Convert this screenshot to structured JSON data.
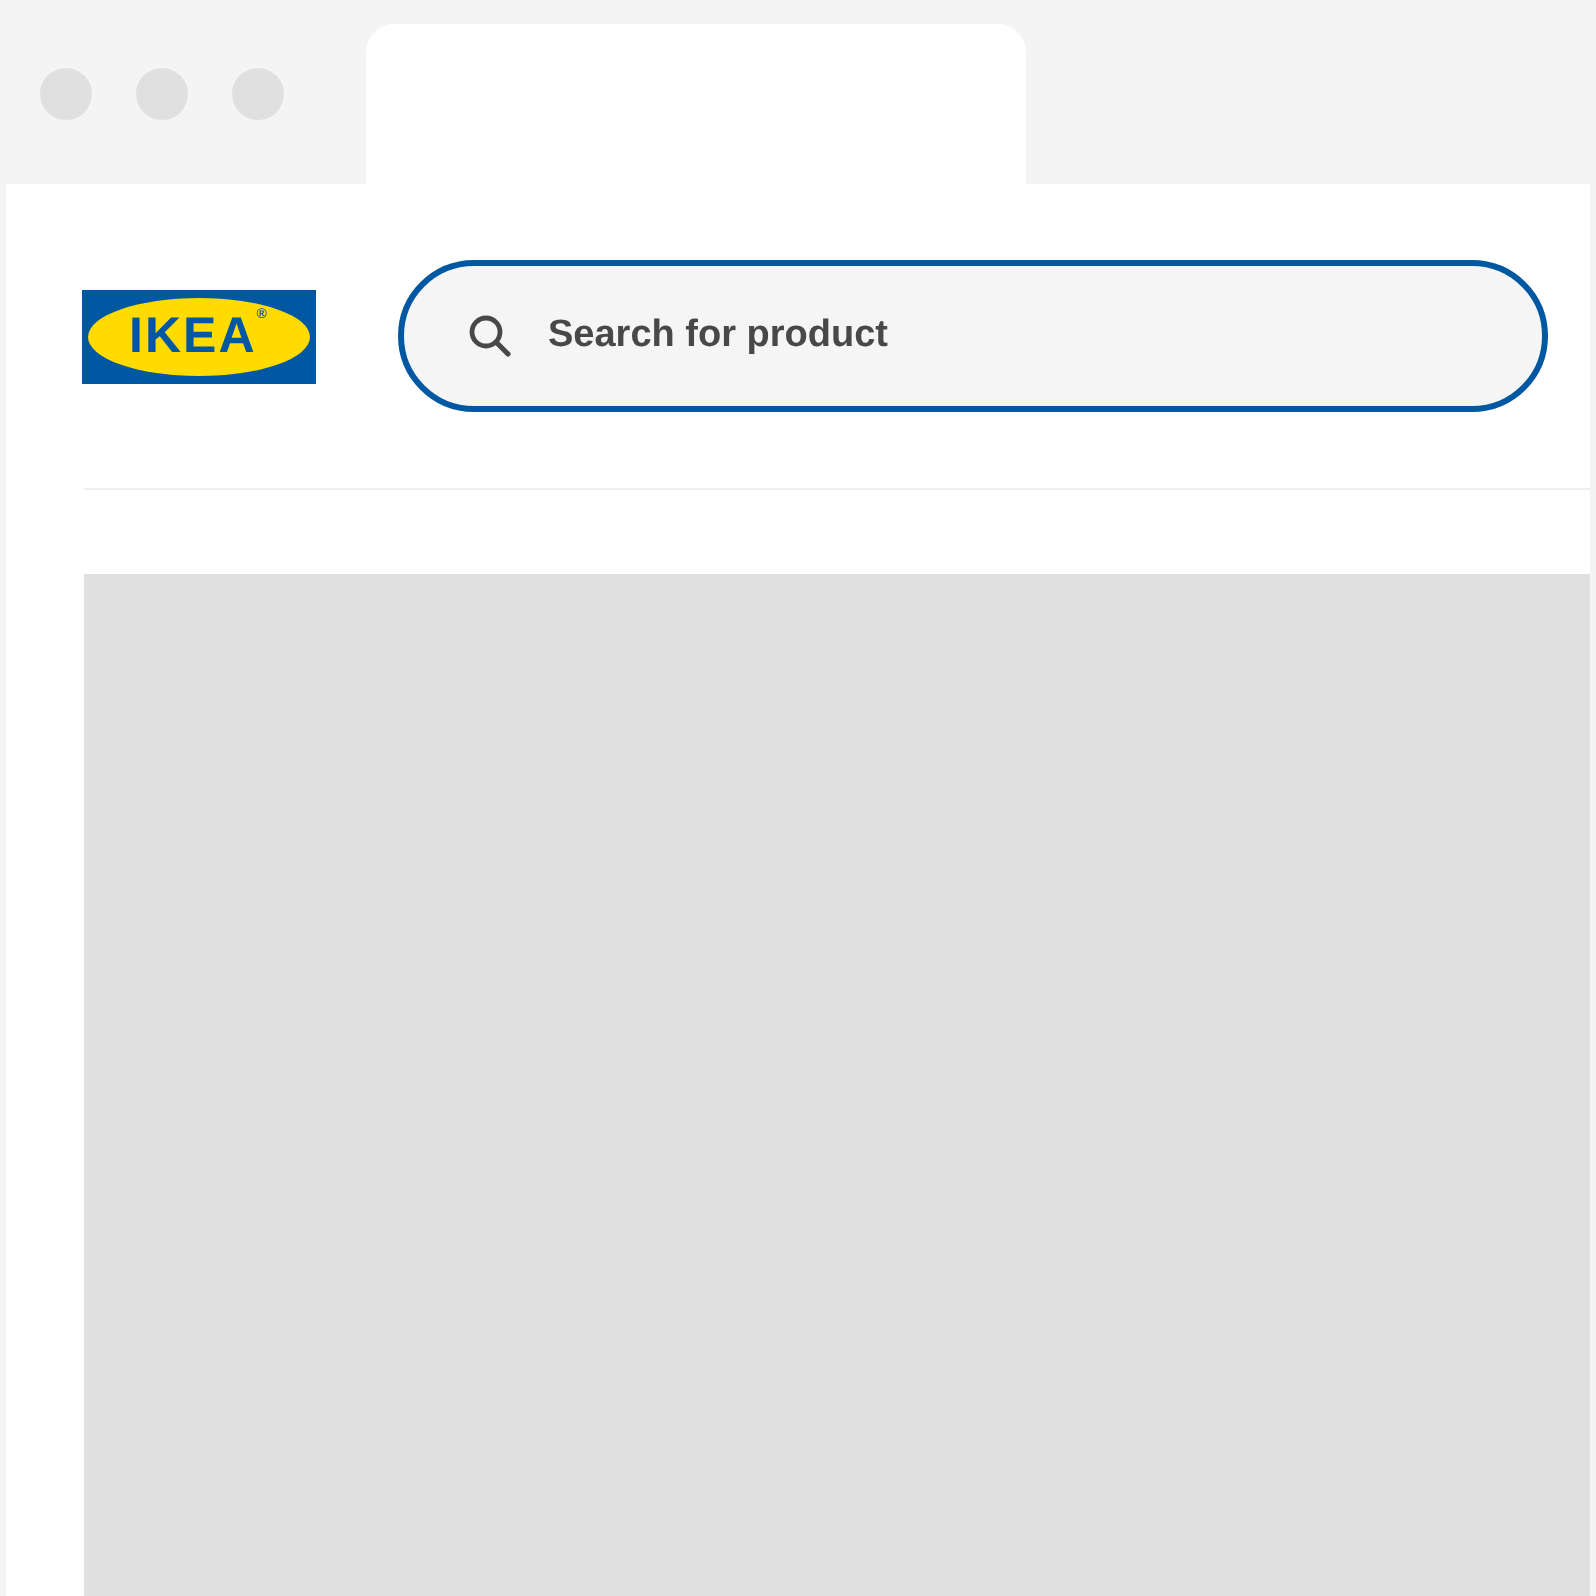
{
  "logo": {
    "text": "IKEA$^{®}$"
  },
  "search": {
    "placeholder": "Search for product"
  }
}
